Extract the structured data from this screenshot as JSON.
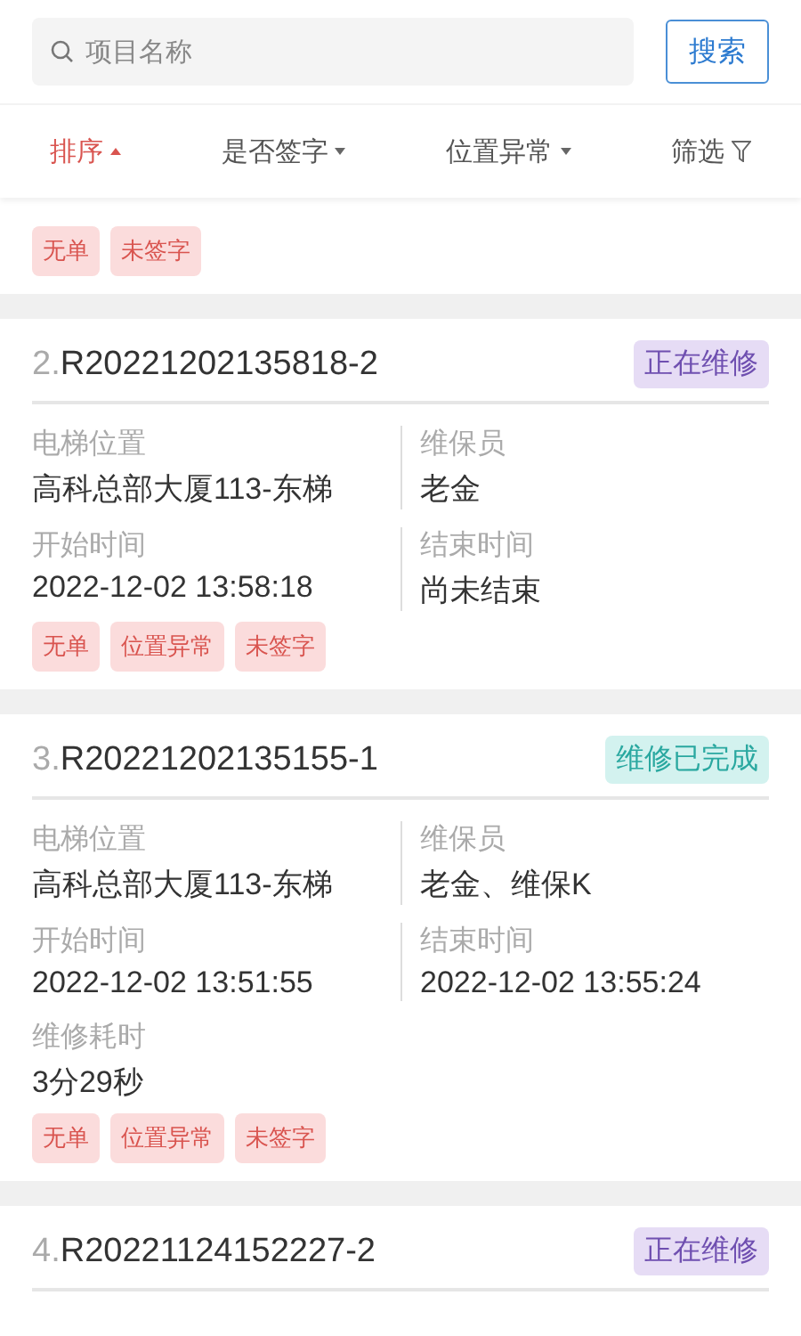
{
  "search": {
    "placeholder": "项目名称",
    "button": "搜索"
  },
  "filters": [
    {
      "label": "排序",
      "kind": "sort",
      "selected": true
    },
    {
      "label": "是否签字",
      "kind": "dropdown",
      "selected": false
    },
    {
      "label": "位置异常",
      "kind": "dropdown",
      "selected": false
    },
    {
      "label": "筛选",
      "kind": "filter",
      "selected": false
    }
  ],
  "orders": [
    {
      "tags": [
        "无单",
        "未签字"
      ]
    },
    {
      "index": "2.",
      "code": "R20221202135818-2",
      "status": {
        "text": "正在维修",
        "kind": "in_progress"
      },
      "fields": [
        {
          "label": "电梯位置",
          "value": "高科总部大厦113-东梯"
        },
        {
          "label": "维保员",
          "value": "老金"
        },
        {
          "label": "开始时间",
          "value": "2022-12-02 13:58:18"
        },
        {
          "label": "结束时间",
          "value": "尚未结束"
        }
      ],
      "tags": [
        "无单",
        "位置异常",
        "未签字"
      ]
    },
    {
      "index": "3.",
      "code": "R20221202135155-1",
      "status": {
        "text": "维修已完成",
        "kind": "done"
      },
      "fields": [
        {
          "label": "电梯位置",
          "value": "高科总部大厦113-东梯"
        },
        {
          "label": "维保员",
          "value": "老金、维保K"
        },
        {
          "label": "开始时间",
          "value": "2022-12-02 13:51:55"
        },
        {
          "label": "结束时间",
          "value": "2022-12-02 13:55:24"
        },
        {
          "label": "维修耗时",
          "value": "3分29秒"
        }
      ],
      "tags": [
        "无单",
        "位置异常",
        "未签字"
      ]
    },
    {
      "index": "4.",
      "code": "R20221124152227-2",
      "status": {
        "text": "正在维修",
        "kind": "in_progress"
      }
    }
  ]
}
